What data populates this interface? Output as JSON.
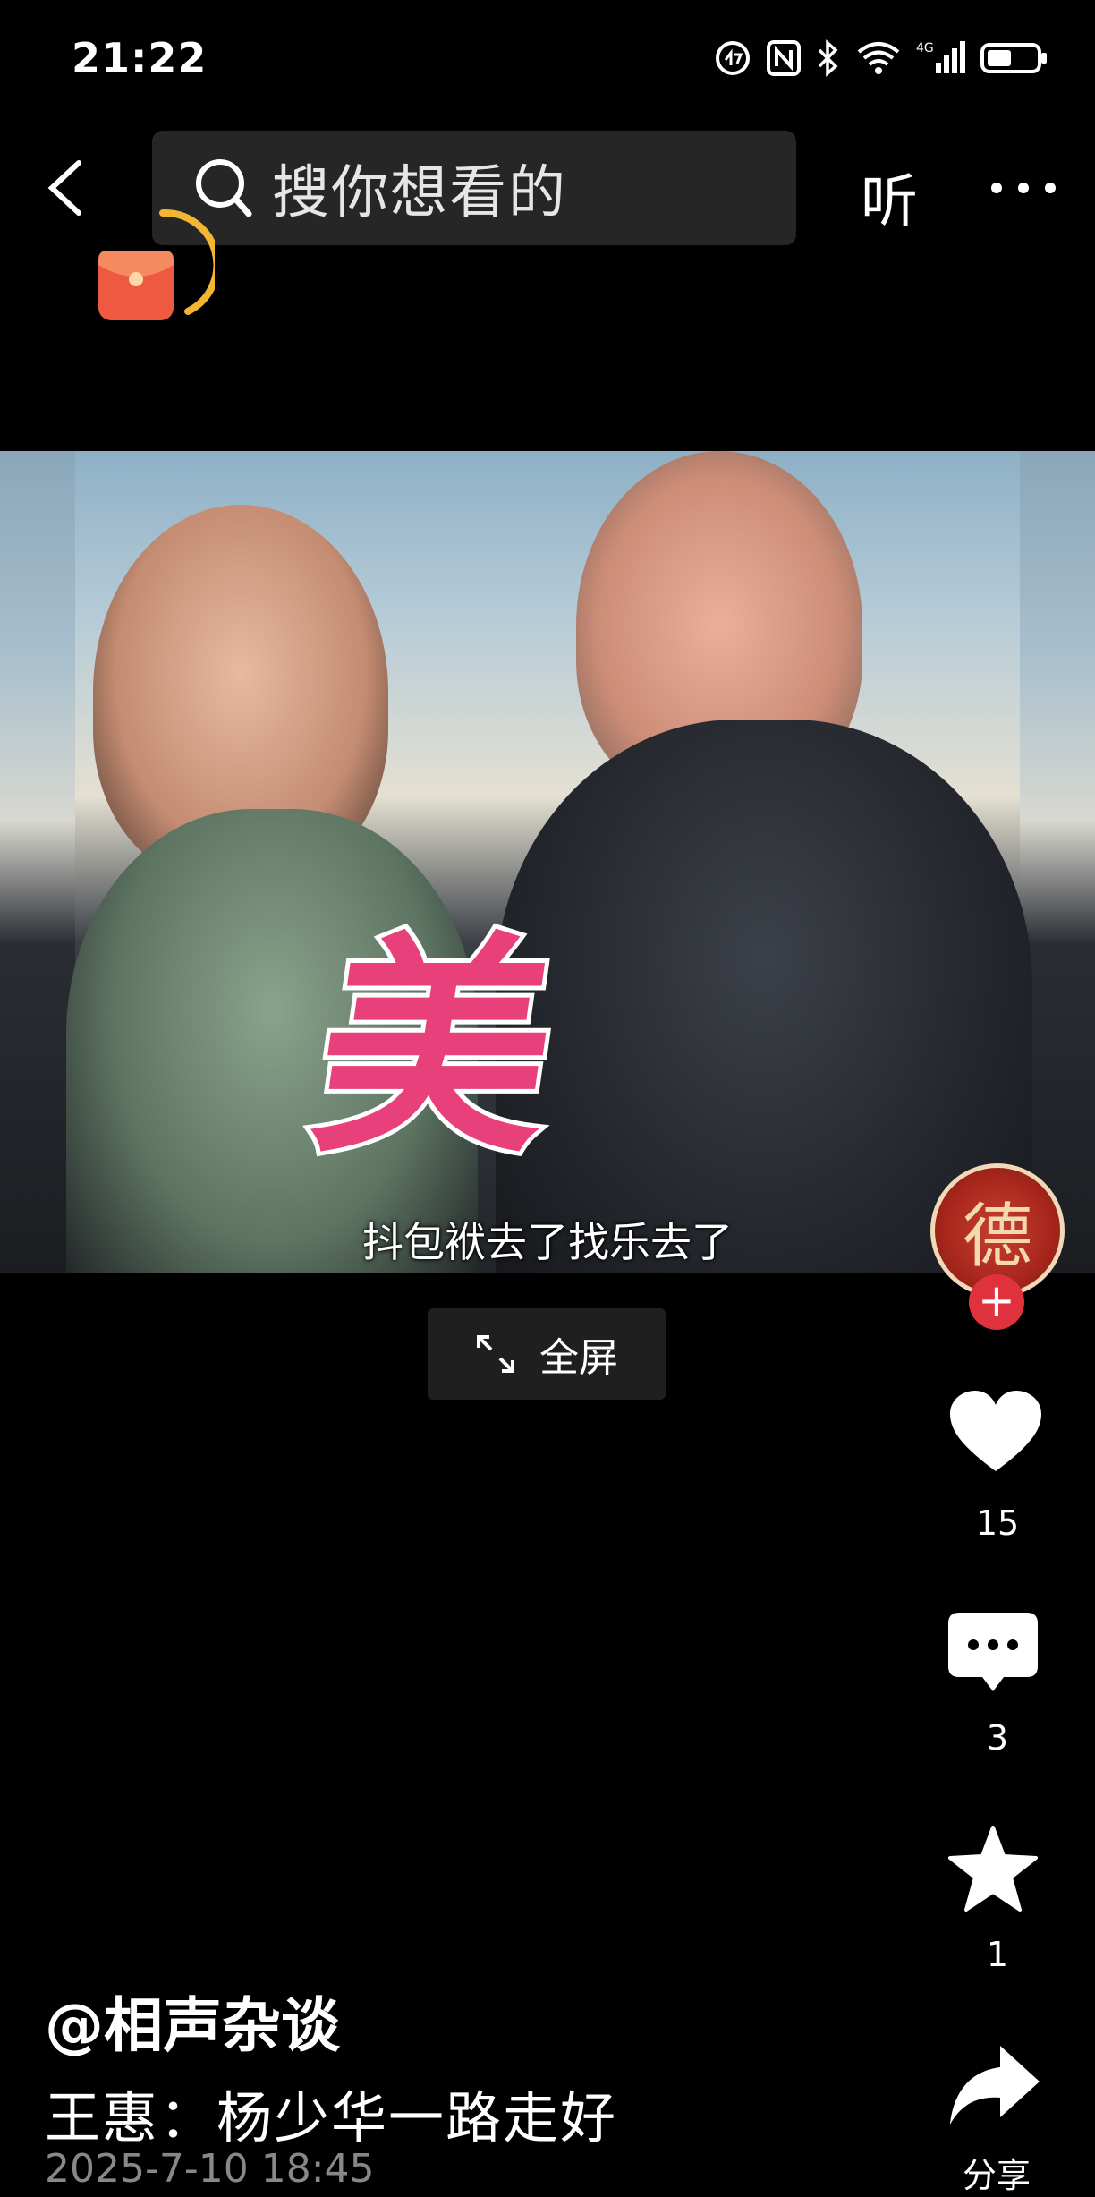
{
  "status_bar": {
    "time": "21:22"
  },
  "top_bar": {
    "search_placeholder": "搜你想看的",
    "listen_label": "听"
  },
  "video": {
    "caption": "抖包袱去了找乐去了",
    "overlay_char": "美",
    "avatar_char": "德"
  },
  "fullscreen": {
    "label": "全屏"
  },
  "actions": {
    "likes": "15",
    "comments": "3",
    "favorites": "1",
    "share_label": "分享"
  },
  "post": {
    "author": "@相声杂谈",
    "description": "王惠：杨少华一路走好",
    "date": "2025-7-10 18:45"
  },
  "colors": {
    "accent_red": "#e0323c",
    "overlay_pink": "#e8407a",
    "background": "#000000"
  }
}
